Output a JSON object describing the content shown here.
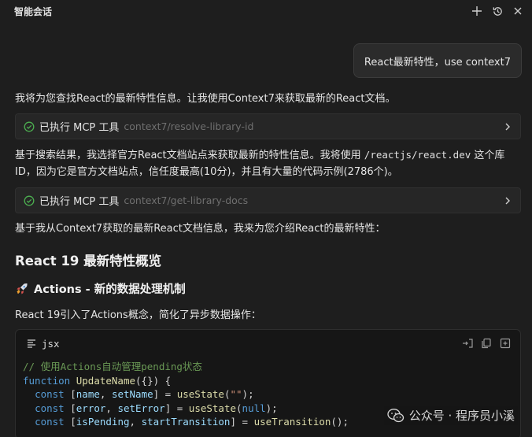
{
  "header": {
    "title": "智能会话",
    "icons": [
      "plus-icon",
      "history-icon",
      "close-icon"
    ]
  },
  "user_message": "React最新特性，use context7",
  "messages": {
    "intro": "我将为您查找React的最新特性信息。让我使用Context7来获取最新的React文档。",
    "tool1": {
      "status": "已执行 MCP 工具",
      "name": "context7/resolve-library-id"
    },
    "reason_line1_pre": "基于搜索结果，我选择官方React文档站点来获取最新的特性信息。我将使用 ",
    "reason_code": "/reactjs/react.dev",
    "reason_line1_post": " 这个库",
    "reason_line2": "ID，因为它是官方文档站点，信任度最高(10分)，并且有大量的代码示例(2786个)。",
    "tool2": {
      "status": "已执行 MCP 工具",
      "name": "context7/get-library-docs"
    },
    "summary_intro": "基于我从Context7获取的最新React文档信息，我来为您介绍React的最新特性："
  },
  "content": {
    "heading": "React 19 最新特性概览",
    "subheading": "Actions - 新的数据处理机制",
    "subheading_icon": "rocket-icon",
    "desc": "React 19引入了Actions概念，简化了异步数据操作："
  },
  "code_block": {
    "lang": "jsx",
    "lines": {
      "l1": "// 使用Actions自动管理pending状态",
      "l2_kw": "function",
      "l2_fn": "UpdateName",
      "l2_rest": "({}) {",
      "l3_kw": "const",
      "l3_a": "name",
      "l3_b": "setName",
      "l3_fn": "useState",
      "l3_arg": "\"\"",
      "l4_kw": "const",
      "l4_a": "error",
      "l4_b": "setError",
      "l4_fn": "useState",
      "l4_arg": "null",
      "l5_kw": "const",
      "l5_a": "isPending",
      "l5_b": "startTransition",
      "l5_fn": "useTransition"
    },
    "tools": [
      "insert-icon",
      "copy-icon",
      "add-file-icon"
    ]
  },
  "watermark": {
    "text": "公众号 · 程序员小溪"
  },
  "colors": {
    "background": "#1e1e1e",
    "success": "#4caf50",
    "comment": "#6a9955",
    "keyword": "#569cd6",
    "function": "#dcdcaa",
    "variable": "#9cdcfe"
  }
}
